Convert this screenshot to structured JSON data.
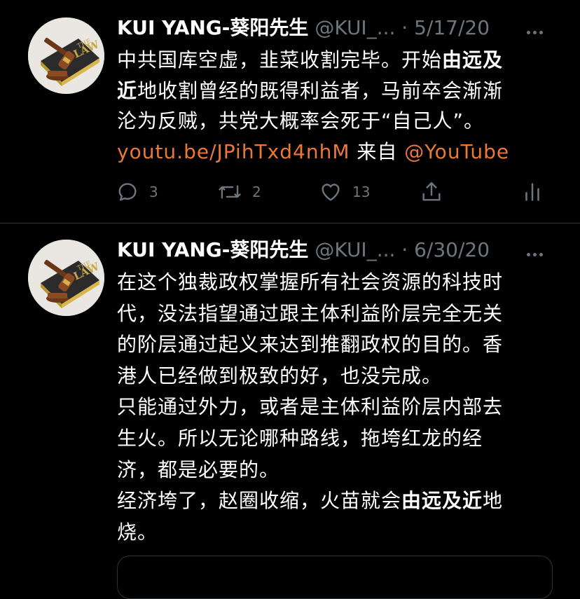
{
  "tweets": [
    {
      "author_name": "KUI YANG-葵阳先生",
      "handle": "@KUI_...",
      "sep": " · ",
      "date": "5/17/20",
      "lines": [
        [
          {
            "t": "中共国库空虚，韭菜收割完毕。开始"
          },
          {
            "t": "由远及",
            "s": "b"
          }
        ],
        [
          {
            "t": "近",
            "s": "b"
          },
          {
            "t": "地收割曾经的既得利益者，马前卒会渐渐"
          }
        ],
        [
          {
            "t": "沦为反贼，共党大概率会死于“自己人”。"
          }
        ],
        [
          {
            "t": "youtu.be/JPihTxd4nhM",
            "s": "link"
          },
          {
            "t": " 来自 "
          },
          {
            "t": "@YouTube",
            "s": "link"
          }
        ]
      ],
      "stats": {
        "replies": "3",
        "retweets": "2",
        "likes": "13"
      }
    },
    {
      "author_name": "KUI YANG-葵阳先生",
      "handle": "@KUI_...",
      "sep": " · ",
      "date": "6/30/20",
      "lines": [
        [
          {
            "t": "在这个独裁政权掌握所有社会资源的科技时"
          }
        ],
        [
          {
            "t": "代，没法指望通过跟主体利益阶层完全无关"
          }
        ],
        [
          {
            "t": "的阶层通过起义来达到推翻政权的目的。香"
          }
        ],
        [
          {
            "t": "港人已经做到极致的好，也没完成。"
          }
        ],
        [
          {
            "t": "只能通过外力，或者是主体利益阶层内部去"
          }
        ],
        [
          {
            "t": "生火。所以无论哪种路线，拖垮红龙的经"
          }
        ],
        [
          {
            "t": "济，都是必要的。"
          }
        ],
        [
          {
            "t": "经济垮了，赵圈收缩，火苗就会"
          },
          {
            "t": "由远及近",
            "s": "b"
          },
          {
            "t": "地"
          }
        ],
        [
          {
            "t": "烧。"
          }
        ]
      ]
    }
  ],
  "avatar": {
    "book_text_1": "THE",
    "book_text_2": "LAW"
  },
  "colors": {
    "background": "#000000",
    "text": "#ffffff",
    "muted": "#6e767d",
    "link": "#e8793a",
    "divider": "#2f3336"
  },
  "icons": [
    "reply-icon",
    "retweet-icon",
    "like-icon",
    "share-icon",
    "analytics-icon",
    "more-icon"
  ]
}
